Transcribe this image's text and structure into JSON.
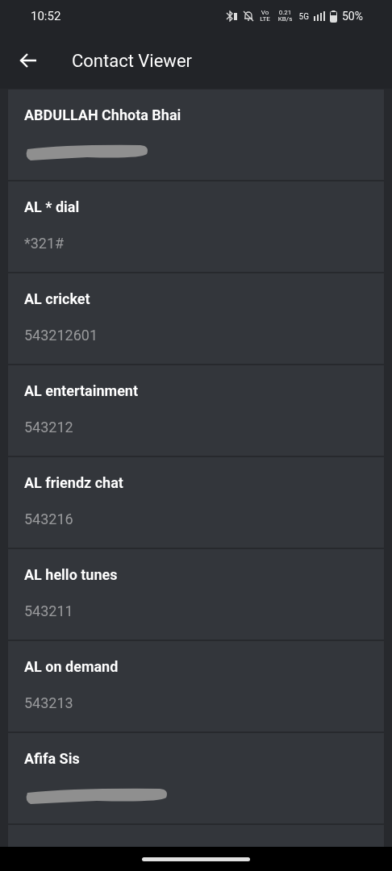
{
  "status_bar": {
    "time": "10:52",
    "volte": "Vo LTE",
    "speed": "0.21 KB/s",
    "network": "5G",
    "battery": "50%"
  },
  "app_bar": {
    "title": "Contact Viewer"
  },
  "contacts": [
    {
      "name": "ABDULLAH Chhota Bhai",
      "kind": "redacted"
    },
    {
      "name": "AL * dial",
      "number": "*321#",
      "kind": "number"
    },
    {
      "name": "AL cricket",
      "number": "543212601",
      "kind": "number"
    },
    {
      "name": "AL entertainment",
      "number": "543212",
      "kind": "number"
    },
    {
      "name": "AL friendz chat",
      "number": "543216",
      "kind": "number"
    },
    {
      "name": "AL hello tunes",
      "number": "543211",
      "kind": "number"
    },
    {
      "name": "AL on demand",
      "number": "543213",
      "kind": "number"
    },
    {
      "name": "Afifa Sis",
      "kind": "redacted"
    },
    {
      "kind": "partial"
    }
  ]
}
